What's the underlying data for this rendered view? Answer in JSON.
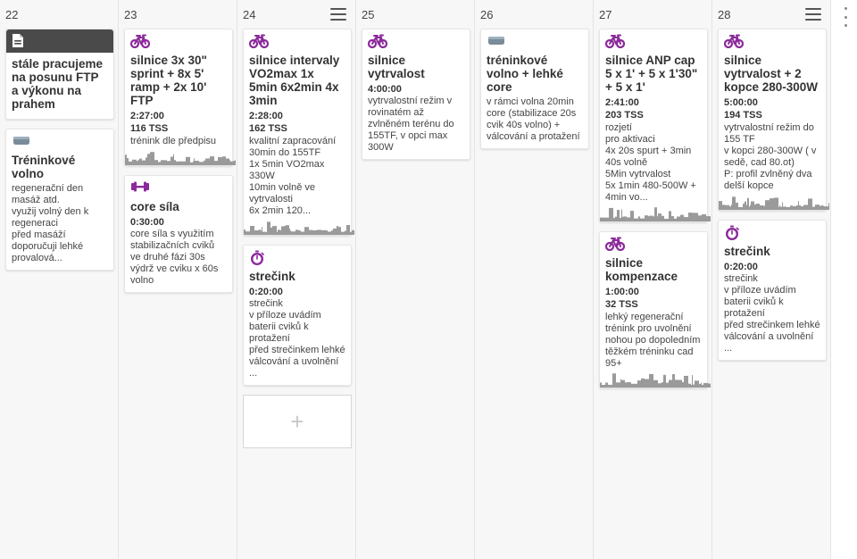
{
  "colors": {
    "accent": "#8b2a9b",
    "gray_icon": "#7a8b99",
    "note_header": "#4a4a4a",
    "spark": "#9a9a9a"
  },
  "days": [
    {
      "num": "22",
      "menu": false,
      "cards": [
        {
          "kind": "note",
          "icon": "document-icon",
          "title": "stále pracujeme na posunu FTP a výkonu na prahem"
        },
        {
          "kind": "rest",
          "icon": "rest-icon",
          "title": "Tréninkové volno",
          "desc": "regenerační den masáž atd.\nvyužij volný den k regeneraci\npřed masáží doporučuji lehké provalová..."
        }
      ]
    },
    {
      "num": "23",
      "menu": false,
      "cards": [
        {
          "kind": "bike",
          "icon": "bike-icon",
          "title": "silnice 3x 30\" sprint + 8x 5' ramp + 2x 10' FTP",
          "dur": "2:27:00",
          "tss": "116 TSS",
          "desc": "trénink dle předpisu",
          "spark": true
        },
        {
          "kind": "strength",
          "icon": "dumbbell-icon",
          "title": "core síla",
          "dur": "0:30:00",
          "desc": "core síla s využitím stabilizačních cviků ve druhé fázi 30s výdrž ve cviku x 60s volno"
        }
      ]
    },
    {
      "num": "24",
      "menu": true,
      "cards": [
        {
          "kind": "bike",
          "icon": "bike-icon",
          "title": "silnice intervaly VO2max 1x 5min 6x2min 4x 3min",
          "dur": "2:28:00",
          "tss": "162 TSS",
          "desc": "kvalitní zapracování 30min do 155TF\n1x 5min VO2max 330W\n10min volně ve vytrvalosti\n6x 2min 120...",
          "spark": true
        },
        {
          "kind": "stretch",
          "icon": "stopwatch-icon",
          "title": "strečink",
          "dur": "0:20:00",
          "desc": "strečink\nv příloze uvádím baterii cviků k protažení\npřed strečinkem lehké válcování a uvolnění ..."
        }
      ],
      "add": "+"
    },
    {
      "num": "25",
      "menu": false,
      "cards": [
        {
          "kind": "bike",
          "icon": "bike-icon",
          "title": "silnice vytrvalost",
          "dur": "4:00:00",
          "desc": "vytrvalostní režim v rovinatém až zvlněném terénu do 155TF, v opci max 300W"
        }
      ]
    },
    {
      "num": "26",
      "menu": false,
      "cards": [
        {
          "kind": "rest",
          "icon": "rest-icon",
          "title": "tréninkové volno + lehké core",
          "desc": "v rámci volna 20min core (stabilizace 20s cvik 40s volno) + válcování a protažení"
        }
      ]
    },
    {
      "num": "27",
      "menu": false,
      "cards": [
        {
          "kind": "bike",
          "icon": "bike-icon",
          "title": "silnice ANP cap 5 x 1' + 5 x 1'30\" + 5 x 1'",
          "dur": "2:41:00",
          "tss": "203 TSS",
          "desc": "rozjetí\npro aktivaci\n4x 20s spurt + 3min 40s volně\n5Min vytrvalost\n5x 1min 480-500W + 4min vo...",
          "spark": true
        },
        {
          "kind": "bike",
          "icon": "bike-icon",
          "title": "silnice kompenzace",
          "dur": "1:00:00",
          "tss": "32 TSS",
          "desc": "lehký regenerační trénink pro uvolnění nohou po dopoledním těžkém tréninku cad 95+",
          "spark": true
        }
      ]
    },
    {
      "num": "28",
      "menu": true,
      "cards": [
        {
          "kind": "bike",
          "icon": "bike-icon",
          "title": "silnice vytrvalost + 2 kopce 280-300W",
          "dur": "5:00:00",
          "tss": "194 TSS",
          "desc": "vytrvalostní režim do 155 TF\nv kopci 280-300W ( v sedě, cad 80.ot)\nP: profil zvlněný dva delší kopce",
          "spark": true
        },
        {
          "kind": "stretch",
          "icon": "stopwatch-icon",
          "title": "strečink",
          "dur": "0:20:00",
          "desc": "strečink\nv příloze uvádím baterii cviků k protažení\npřed strečinkem lehké válcování a uvolnění ..."
        }
      ]
    }
  ]
}
